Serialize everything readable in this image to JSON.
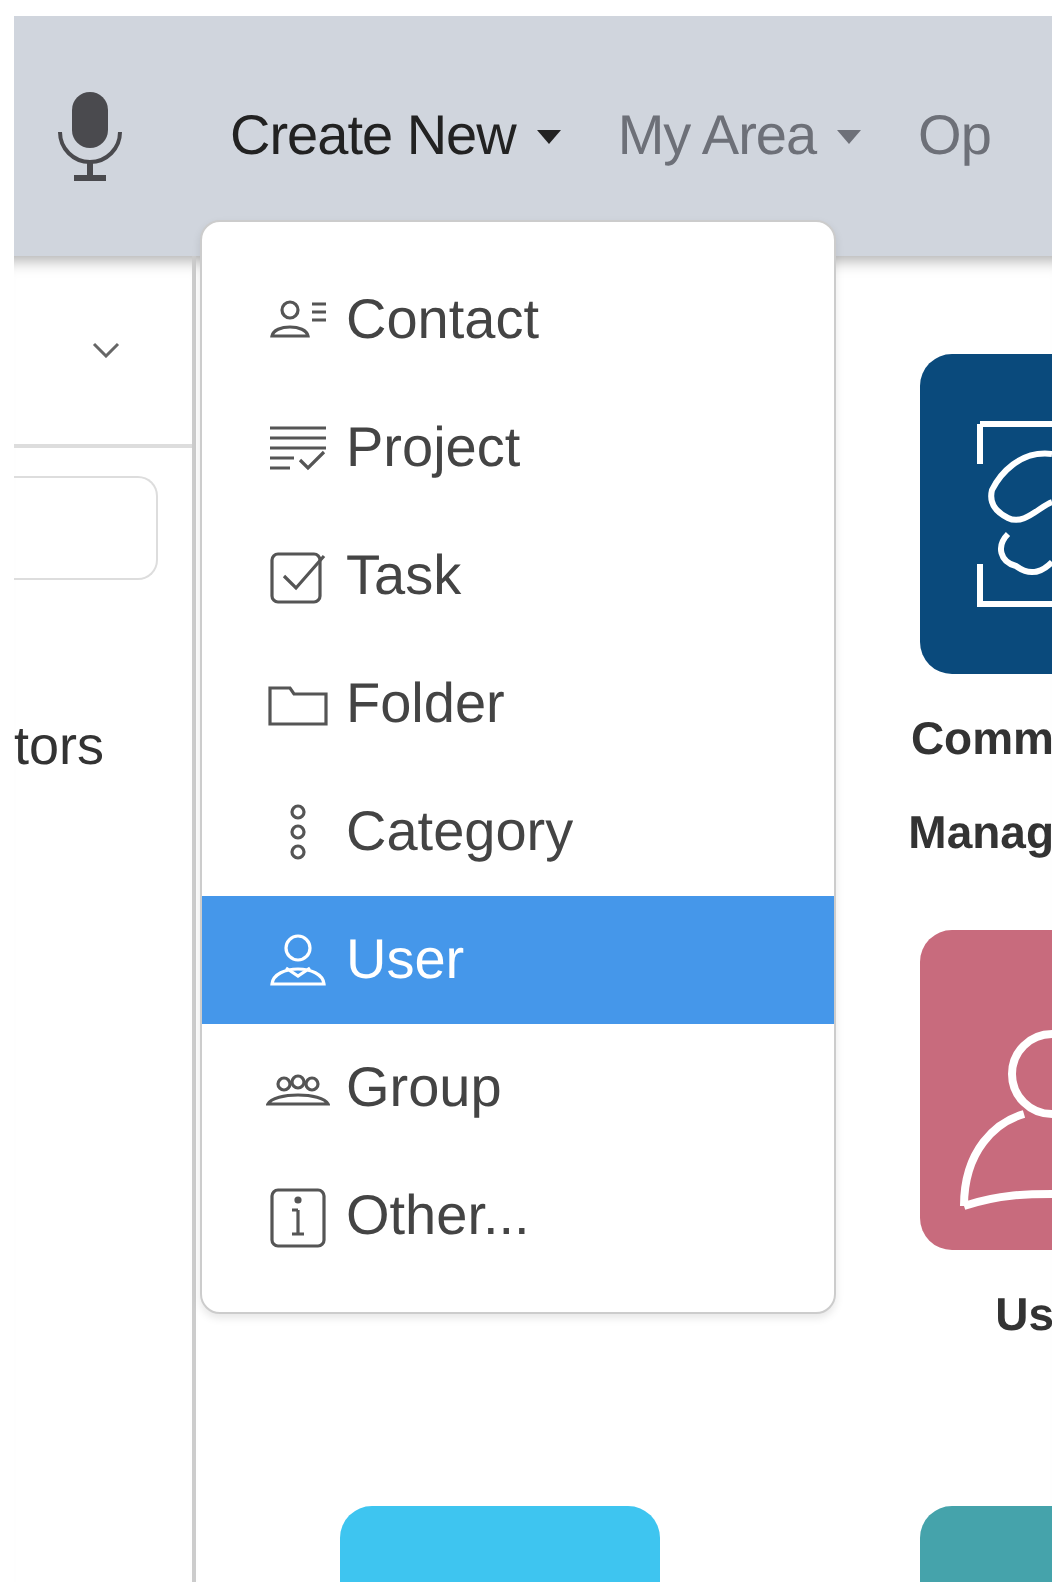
{
  "navbar": {
    "items": [
      {
        "label": "Create New",
        "selected": true,
        "caret": true
      },
      {
        "label": "My Area",
        "selected": false,
        "caret": true
      },
      {
        "label": "Op",
        "selected": false,
        "caret": false
      }
    ]
  },
  "sidebar": {
    "label": "tors"
  },
  "tiles": [
    {
      "kind": "hidden"
    },
    {
      "kind": "tile",
      "color": "#0a4a7c",
      "caption": [
        "Comm",
        "Manag"
      ]
    },
    {
      "kind": "hidden"
    },
    {
      "kind": "tile",
      "color": "#c86b7d",
      "caption": [
        "Us"
      ]
    },
    {
      "kind": "tile",
      "color": "#3ec5f0"
    },
    {
      "kind": "tile",
      "color": "#45a3ab"
    }
  ],
  "dropdown": {
    "items": [
      {
        "label": "Contact",
        "selected": false
      },
      {
        "label": "Project",
        "selected": false
      },
      {
        "label": "Task",
        "selected": false
      },
      {
        "label": "Folder",
        "selected": false
      },
      {
        "label": "Category",
        "selected": false
      },
      {
        "label": "User",
        "selected": true
      },
      {
        "label": "Group",
        "selected": false
      },
      {
        "label": "Other...",
        "selected": false
      }
    ]
  }
}
